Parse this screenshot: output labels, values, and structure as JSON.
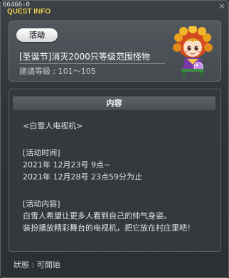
{
  "window": {
    "id_label": "66466-0",
    "title": "QUEST INFO",
    "close_glyph": "×"
  },
  "event": {
    "tag": "活动",
    "name": "[圣诞节]消灭2000只等级范围怪物",
    "level": "建議等級 : 101～105",
    "npc_icon": "girl-npc-icon"
  },
  "content": {
    "header": "内容",
    "lines": [
      "<白雪人电视机>",
      "",
      "[活动时间]",
      "2021年 12月23号 9点~",
      "2021年 12月28号 23点59分为止",
      "",
      "[活动内容]",
      "白雪人希望让更多人看到自己的帅气身姿。",
      "装扮播放精彩舞台的电视机，把它放在村庄里吧！"
    ]
  },
  "status": {
    "text": "狀態 : 可開始"
  },
  "colors": {
    "title": "#f3d65d",
    "panel": "#454b50",
    "content_bg": "#34393e"
  }
}
